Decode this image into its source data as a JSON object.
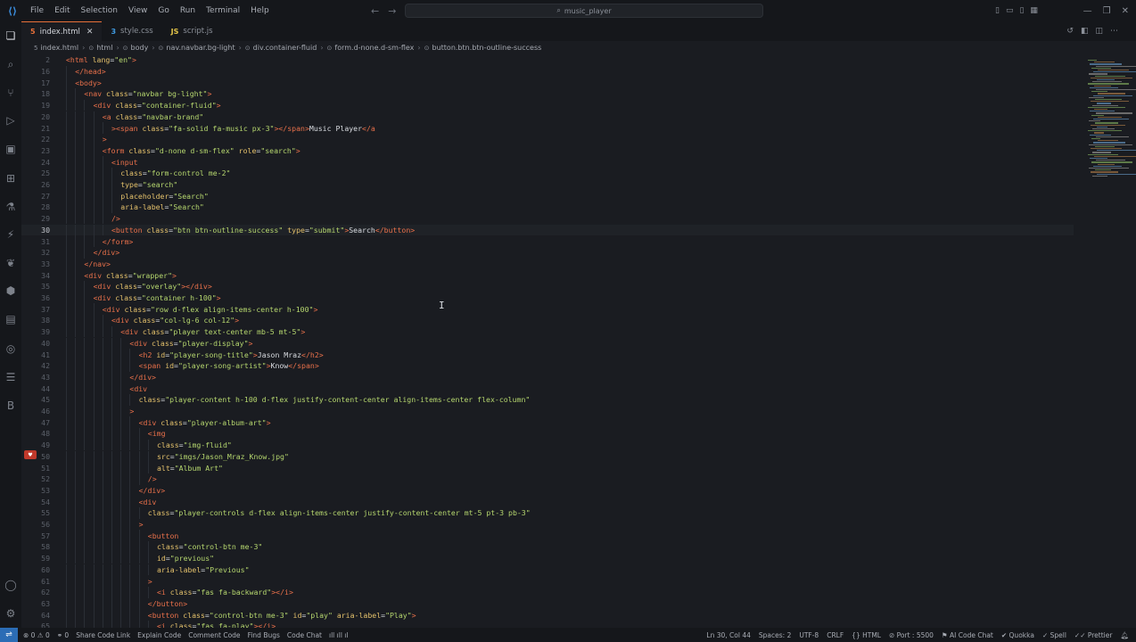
{
  "menu": [
    "File",
    "Edit",
    "Selection",
    "View",
    "Go",
    "Run",
    "Terminal",
    "Help"
  ],
  "search_box": "music_player",
  "tabs": [
    {
      "label": "index.html",
      "icon": "html-icon"
    },
    {
      "label": "style.css",
      "icon": "css-icon"
    },
    {
      "label": "script.js",
      "icon": "js-icon"
    }
  ],
  "breadcrumb": [
    "index.html",
    "html",
    "body",
    "nav.navbar.bg-light",
    "div.container-fluid",
    "form.d-none.d-sm-flex",
    "button.btn.btn-outline-success"
  ],
  "code_lines": [
    {
      "n": "2",
      "i": 0,
      "t": "<html lang=\"en\">"
    },
    {
      "n": "16",
      "i": 1,
      "t": "</head>"
    },
    {
      "n": "17",
      "i": 1,
      "t": "<body>"
    },
    {
      "n": "18",
      "i": 2,
      "t": "<nav class=\"navbar bg-light\">"
    },
    {
      "n": "19",
      "i": 3,
      "t": "<div class=\"container-fluid\">"
    },
    {
      "n": "20",
      "i": 4,
      "t": "<a class=\"navbar-brand\""
    },
    {
      "n": "21",
      "i": 5,
      "t": "><span class=\"fa-solid fa-music px-3\"></span>Music Player</a"
    },
    {
      "n": "22",
      "i": 4,
      "t": ">"
    },
    {
      "n": "23",
      "i": 4,
      "t": "<form class=\"d-none d-sm-flex\" role=\"search\">"
    },
    {
      "n": "24",
      "i": 5,
      "t": "<input"
    },
    {
      "n": "25",
      "i": 6,
      "t": "class=\"form-control me-2\""
    },
    {
      "n": "26",
      "i": 6,
      "t": "type=\"search\""
    },
    {
      "n": "27",
      "i": 6,
      "t": "placeholder=\"Search\""
    },
    {
      "n": "28",
      "i": 6,
      "t": "aria-label=\"Search\""
    },
    {
      "n": "29",
      "i": 5,
      "t": "/>"
    },
    {
      "n": "30",
      "i": 5,
      "t": "<button class=\"btn btn-outline-success\" type=\"submit\">Search</button>"
    },
    {
      "n": "31",
      "i": 4,
      "t": "</form>"
    },
    {
      "n": "32",
      "i": 3,
      "t": "</div>"
    },
    {
      "n": "33",
      "i": 2,
      "t": "</nav>"
    },
    {
      "n": "34",
      "i": 2,
      "t": "<div class=\"wrapper\">"
    },
    {
      "n": "35",
      "i": 3,
      "t": "<div class=\"overlay\"></div>"
    },
    {
      "n": "36",
      "i": 3,
      "t": "<div class=\"container h-100\">"
    },
    {
      "n": "37",
      "i": 4,
      "t": "<div class=\"row d-flex align-items-center h-100\">"
    },
    {
      "n": "38",
      "i": 5,
      "t": "<div class=\"col-lg-6 col-12\">"
    },
    {
      "n": "39",
      "i": 6,
      "t": "<div class=\"player text-center mb-5 mt-5\">"
    },
    {
      "n": "40",
      "i": 7,
      "t": "<div class=\"player-display\">"
    },
    {
      "n": "41",
      "i": 8,
      "t": "<h2 id=\"player-song-title\">Jason Mraz</h2>"
    },
    {
      "n": "42",
      "i": 8,
      "t": "<span id=\"player-song-artist\">Know</span>"
    },
    {
      "n": "43",
      "i": 7,
      "t": "</div>"
    },
    {
      "n": "44",
      "i": 7,
      "t": "<div"
    },
    {
      "n": "45",
      "i": 8,
      "t": "class=\"player-content h-100 d-flex justify-content-center align-items-center flex-column\""
    },
    {
      "n": "46",
      "i": 7,
      "t": ">"
    },
    {
      "n": "47",
      "i": 8,
      "t": "<div class=\"player-album-art\">"
    },
    {
      "n": "48",
      "i": 9,
      "t": "<img"
    },
    {
      "n": "49",
      "i": 10,
      "t": "class=\"img-fluid\""
    },
    {
      "n": "50",
      "i": 10,
      "t": "src=\"imgs/Jason_Mraz_Know.jpg\""
    },
    {
      "n": "51",
      "i": 10,
      "t": "alt=\"Album Art\""
    },
    {
      "n": "52",
      "i": 9,
      "t": "/>"
    },
    {
      "n": "53",
      "i": 8,
      "t": "</div>"
    },
    {
      "n": "54",
      "i": 8,
      "t": "<div"
    },
    {
      "n": "55",
      "i": 9,
      "t": "class=\"player-controls d-flex align-items-center justify-content-center mt-5 pt-3 pb-3\""
    },
    {
      "n": "56",
      "i": 8,
      "t": ">"
    },
    {
      "n": "57",
      "i": 9,
      "t": "<button"
    },
    {
      "n": "58",
      "i": 10,
      "t": "class=\"control-btn me-3\""
    },
    {
      "n": "59",
      "i": 10,
      "t": "id=\"previous\""
    },
    {
      "n": "60",
      "i": 10,
      "t": "aria-label=\"Previous\""
    },
    {
      "n": "61",
      "i": 9,
      "t": ">"
    },
    {
      "n": "62",
      "i": 10,
      "t": "<i class=\"fas fa-backward\"></i>"
    },
    {
      "n": "63",
      "i": 9,
      "t": "</button>"
    },
    {
      "n": "64",
      "i": 9,
      "t": "<button class=\"control-btn me-3\" id=\"play\" aria-label=\"Play\">"
    },
    {
      "n": "65",
      "i": 10,
      "t": "<i class=\"fas fa-play\"></i>"
    }
  ],
  "current_line": "30",
  "status": {
    "errors": "0",
    "warnings": "0",
    "ports": "0",
    "share": "Share Code Link",
    "explain": "Explain Code",
    "comment": "Comment Code",
    "bugs": "Find Bugs",
    "chat": "Code Chat",
    "position": "Ln 30, Col 44",
    "spaces": "Spaces: 2",
    "encoding": "UTF-8",
    "eol": "CRLF",
    "language": "HTML",
    "port": "Port : 5500",
    "ai": "AI Code Chat",
    "quokka": "Quokka",
    "spell": "Spell",
    "prettier": "Prettier"
  }
}
